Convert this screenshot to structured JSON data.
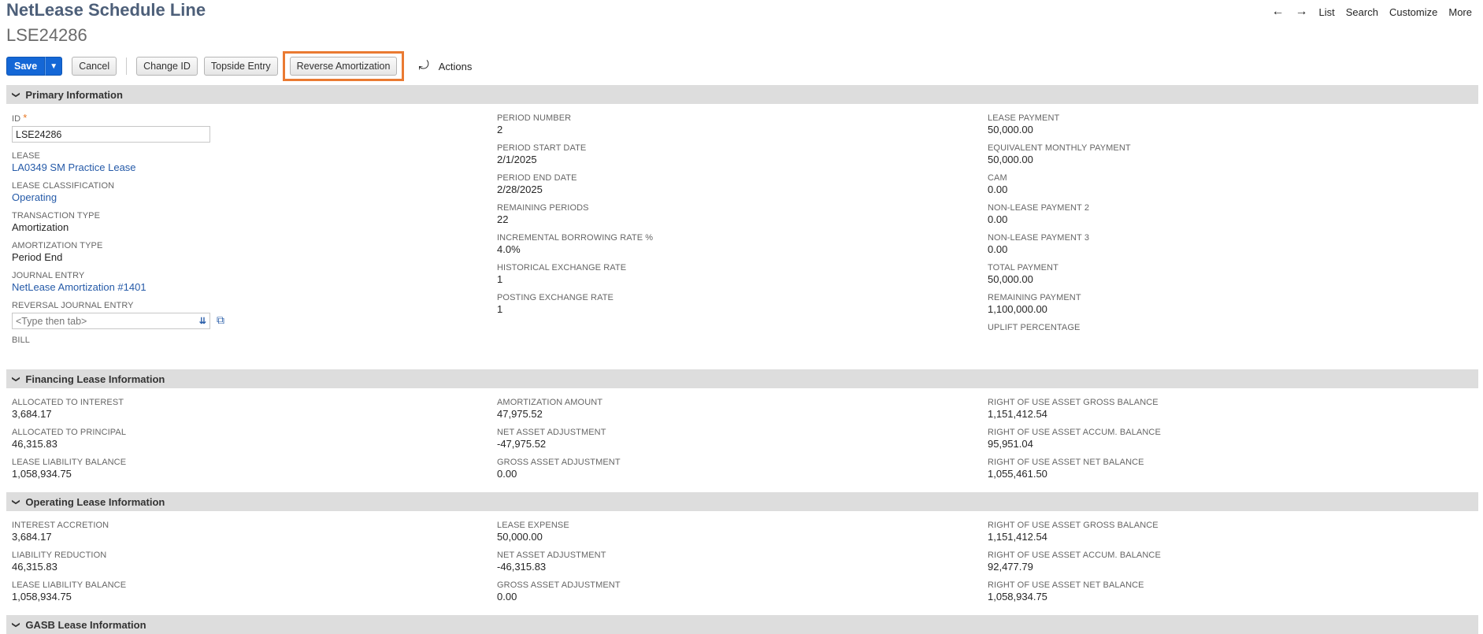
{
  "header": {
    "title": "NetLease Schedule Line",
    "record_id": "LSE24286"
  },
  "topnav": {
    "back_icon": "arrow-left-icon",
    "forward_icon": "arrow-right-icon",
    "list": "List",
    "search": "Search",
    "customize": "Customize",
    "more": "More"
  },
  "toolbar": {
    "save": "Save",
    "cancel": "Cancel",
    "change_id": "Change ID",
    "topside_entry": "Topside Entry",
    "reverse_amortization": "Reverse Amortization",
    "actions": "Actions",
    "highlight_color": "#ea7a32"
  },
  "primary": {
    "section_title": "Primary Information",
    "id_label": "ID",
    "id_value": "LSE24286",
    "lease_label": "LEASE",
    "lease_value": "LA0349 SM Practice Lease",
    "classification_label": "LEASE CLASSIFICATION",
    "classification_value": "Operating",
    "transaction_type_label": "TRANSACTION TYPE",
    "transaction_type_value": "Amortization",
    "amortization_type_label": "AMORTIZATION TYPE",
    "amortization_type_value": "Period End",
    "journal_entry_label": "JOURNAL ENTRY",
    "journal_entry_value": "NetLease Amortization #1401",
    "reversal_label": "REVERSAL JOURNAL ENTRY",
    "reversal_placeholder": "<Type then tab>",
    "bill_label": "BILL",
    "period_number_label": "PERIOD NUMBER",
    "period_number_value": "2",
    "period_start_label": "PERIOD START DATE",
    "period_start_value": "2/1/2025",
    "period_end_label": "PERIOD END DATE",
    "period_end_value": "2/28/2025",
    "remaining_periods_label": "REMAINING PERIODS",
    "remaining_periods_value": "22",
    "ibr_label": "INCREMENTAL BORROWING RATE %",
    "ibr_value": "4.0%",
    "hist_rate_label": "HISTORICAL EXCHANGE RATE",
    "hist_rate_value": "1",
    "posting_rate_label": "POSTING EXCHANGE RATE",
    "posting_rate_value": "1",
    "lease_payment_label": "LEASE PAYMENT",
    "lease_payment_value": "50,000.00",
    "equiv_monthly_label": "EQUIVALENT MONTHLY PAYMENT",
    "equiv_monthly_value": "50,000.00",
    "cam_label": "CAM",
    "cam_value": "0.00",
    "nonlease2_label": "NON-LEASE PAYMENT 2",
    "nonlease2_value": "0.00",
    "nonlease3_label": "NON-LEASE PAYMENT 3",
    "nonlease3_value": "0.00",
    "total_payment_label": "TOTAL PAYMENT",
    "total_payment_value": "50,000.00",
    "remaining_payment_label": "REMAINING PAYMENT",
    "remaining_payment_value": "1,100,000.00",
    "uplift_label": "UPLIFT PERCENTAGE"
  },
  "financing": {
    "section_title": "Financing Lease Information",
    "alloc_interest_label": "ALLOCATED TO INTEREST",
    "alloc_interest_value": "3,684.17",
    "alloc_principal_label": "ALLOCATED TO PRINCIPAL",
    "alloc_principal_value": "46,315.83",
    "liability_balance_label": "LEASE LIABILITY BALANCE",
    "liability_balance_value": "1,058,934.75",
    "amort_amount_label": "AMORTIZATION AMOUNT",
    "amort_amount_value": "47,975.52",
    "net_asset_adj_label": "NET ASSET ADJUSTMENT",
    "net_asset_adj_value": "-47,975.52",
    "gross_asset_adj_label": "GROSS ASSET ADJUSTMENT",
    "gross_asset_adj_value": "0.00",
    "rou_gross_label": "RIGHT OF USE ASSET GROSS BALANCE",
    "rou_gross_value": "1,151,412.54",
    "rou_accum_label": "RIGHT OF USE ASSET ACCUM. BALANCE",
    "rou_accum_value": "95,951.04",
    "rou_net_label": "RIGHT OF USE ASSET NET BALANCE",
    "rou_net_value": "1,055,461.50"
  },
  "operating": {
    "section_title": "Operating Lease Information",
    "interest_accretion_label": "INTEREST ACCRETION",
    "interest_accretion_value": "3,684.17",
    "liability_reduction_label": "LIABILITY REDUCTION",
    "liability_reduction_value": "46,315.83",
    "liability_balance_label": "LEASE LIABILITY BALANCE",
    "liability_balance_value": "1,058,934.75",
    "lease_expense_label": "LEASE EXPENSE",
    "lease_expense_value": "50,000.00",
    "net_asset_adj_label": "NET ASSET ADJUSTMENT",
    "net_asset_adj_value": "-46,315.83",
    "gross_asset_adj_label": "GROSS ASSET ADJUSTMENT",
    "gross_asset_adj_value": "0.00",
    "rou_gross_label": "RIGHT OF USE ASSET GROSS BALANCE",
    "rou_gross_value": "1,151,412.54",
    "rou_accum_label": "RIGHT OF USE ASSET ACCUM. BALANCE",
    "rou_accum_value": "92,477.79",
    "rou_net_label": "RIGHT OF USE ASSET NET BALANCE",
    "rou_net_value": "1,058,934.75"
  },
  "gasb": {
    "section_title": "GASB Lease Information"
  }
}
